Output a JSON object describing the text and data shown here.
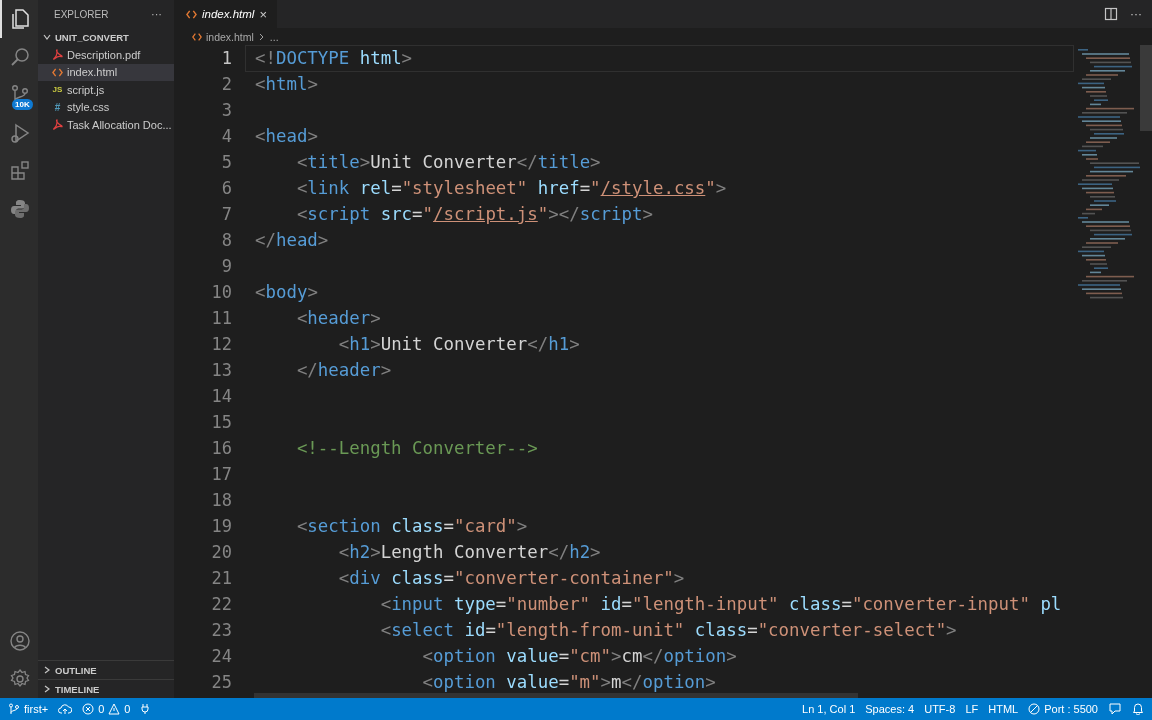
{
  "activity_bar": {
    "items": [
      {
        "kind": "explorer",
        "selected": true
      },
      {
        "kind": "search",
        "selected": false
      },
      {
        "kind": "source-control",
        "selected": false,
        "badge": "10K"
      },
      {
        "kind": "run",
        "selected": false
      },
      {
        "kind": "extensions",
        "selected": false
      },
      {
        "kind": "python",
        "selected": false
      }
    ],
    "bottom_items": [
      {
        "kind": "account"
      },
      {
        "kind": "settings"
      }
    ]
  },
  "sidebar": {
    "title": "EXPLORER",
    "more": "···",
    "folder": {
      "name": "UNIT_CONVERT",
      "expanded": true,
      "files": [
        {
          "name": "Description.pdf",
          "kind": "pdf",
          "selected": false
        },
        {
          "name": "index.html",
          "kind": "html",
          "selected": true
        },
        {
          "name": "script.js",
          "kind": "js",
          "glyph": "JS",
          "selected": false
        },
        {
          "name": "style.css",
          "kind": "css",
          "glyph": "#",
          "selected": false
        },
        {
          "name": "Task Allocation Doc...",
          "kind": "pdf",
          "selected": false
        }
      ]
    },
    "sections": [
      {
        "name": "OUTLINE",
        "expanded": false
      },
      {
        "name": "TIMELINE",
        "expanded": false
      }
    ]
  },
  "tabs": [
    {
      "label": "index.html",
      "selected": true,
      "preview": true,
      "close": "×"
    }
  ],
  "breadcrumb": [
    "index.html",
    "..."
  ],
  "editor_actions": {
    "more": "···"
  },
  "code": [
    {
      "number": "1",
      "current": true,
      "tokens": [
        {
          "kind": "punct",
          "text": "<!"
        },
        {
          "kind": "tag",
          "text": "DOCTYPE"
        },
        {
          "kind": "attr",
          "text": " html"
        },
        {
          "kind": "punct",
          "text": ">"
        }
      ]
    },
    {
      "number": "2",
      "current": false,
      "tokens": [
        {
          "kind": "punct",
          "text": "<"
        },
        {
          "kind": "tag",
          "text": "html"
        },
        {
          "kind": "punct",
          "text": ">"
        }
      ]
    },
    {
      "number": "3",
      "current": false
    },
    {
      "number": "4",
      "current": false,
      "tokens": [
        {
          "kind": "punct",
          "text": "<"
        },
        {
          "kind": "tag",
          "text": "head"
        },
        {
          "kind": "punct",
          "text": ">"
        }
      ]
    },
    {
      "number": "5",
      "current": false,
      "tokens": [
        {
          "kind": "punct",
          "text": "    <"
        },
        {
          "kind": "tag",
          "text": "title"
        },
        {
          "kind": "punct",
          "text": ">"
        },
        {
          "kind": "text",
          "text": "Unit Converter"
        },
        {
          "kind": "punct",
          "text": "</"
        },
        {
          "kind": "tag",
          "text": "title"
        },
        {
          "kind": "punct",
          "text": ">"
        }
      ]
    },
    {
      "number": "6",
      "current": false,
      "tokens": [
        {
          "kind": "punct",
          "text": "    <"
        },
        {
          "kind": "tag",
          "text": "link"
        },
        {
          "kind": "attr",
          "text": " rel"
        },
        {
          "kind": "text",
          "text": "="
        },
        {
          "kind": "string",
          "text": "\"stylesheet\""
        },
        {
          "kind": "attr",
          "text": " href"
        },
        {
          "kind": "text",
          "text": "="
        },
        {
          "kind": "string",
          "text": "\""
        },
        {
          "kind": "link",
          "text": "/style.css"
        },
        {
          "kind": "string",
          "text": "\""
        },
        {
          "kind": "punct",
          "text": ">"
        }
      ]
    },
    {
      "number": "7",
      "current": false,
      "tokens": [
        {
          "kind": "punct",
          "text": "    <"
        },
        {
          "kind": "tag",
          "text": "script"
        },
        {
          "kind": "attr",
          "text": " src"
        },
        {
          "kind": "text",
          "text": "="
        },
        {
          "kind": "string",
          "text": "\""
        },
        {
          "kind": "link",
          "text": "/script.js"
        },
        {
          "kind": "string",
          "text": "\""
        },
        {
          "kind": "punct",
          "text": "></"
        },
        {
          "kind": "tag",
          "text": "script"
        },
        {
          "kind": "punct",
          "text": ">"
        }
      ]
    },
    {
      "number": "8",
      "current": false,
      "tokens": [
        {
          "kind": "punct",
          "text": "</"
        },
        {
          "kind": "tag",
          "text": "head"
        },
        {
          "kind": "punct",
          "text": ">"
        }
      ]
    },
    {
      "number": "9",
      "current": false
    },
    {
      "number": "10",
      "current": false,
      "tokens": [
        {
          "kind": "punct",
          "text": "<"
        },
        {
          "kind": "tag",
          "text": "body"
        },
        {
          "kind": "punct",
          "text": ">"
        }
      ]
    },
    {
      "number": "11",
      "current": false,
      "tokens": [
        {
          "kind": "punct",
          "text": "    <"
        },
        {
          "kind": "tag",
          "text": "header"
        },
        {
          "kind": "punct",
          "text": ">"
        }
      ]
    },
    {
      "number": "12",
      "current": false,
      "tokens": [
        {
          "kind": "punct",
          "text": "        <"
        },
        {
          "kind": "tag",
          "text": "h1"
        },
        {
          "kind": "punct",
          "text": ">"
        },
        {
          "kind": "text",
          "text": "Unit Converter"
        },
        {
          "kind": "punct",
          "text": "</"
        },
        {
          "kind": "tag",
          "text": "h1"
        },
        {
          "kind": "punct",
          "text": ">"
        }
      ]
    },
    {
      "number": "13",
      "current": false,
      "tokens": [
        {
          "kind": "punct",
          "text": "    </"
        },
        {
          "kind": "tag",
          "text": "header"
        },
        {
          "kind": "punct",
          "text": ">"
        }
      ]
    },
    {
      "number": "14",
      "current": false
    },
    {
      "number": "15",
      "current": false
    },
    {
      "number": "16",
      "current": false,
      "tokens": [
        {
          "kind": "comment",
          "text": "    <!--Length Converter-->"
        }
      ]
    },
    {
      "number": "17",
      "current": false
    },
    {
      "number": "18",
      "current": false
    },
    {
      "number": "19",
      "current": false,
      "tokens": [
        {
          "kind": "punct",
          "text": "    <"
        },
        {
          "kind": "tag",
          "text": "section"
        },
        {
          "kind": "attr",
          "text": " class"
        },
        {
          "kind": "text",
          "text": "="
        },
        {
          "kind": "string",
          "text": "\"card\""
        },
        {
          "kind": "punct",
          "text": ">"
        }
      ]
    },
    {
      "number": "20",
      "current": false,
      "tokens": [
        {
          "kind": "punct",
          "text": "        <"
        },
        {
          "kind": "tag",
          "text": "h2"
        },
        {
          "kind": "punct",
          "text": ">"
        },
        {
          "kind": "text",
          "text": "Length Converter"
        },
        {
          "kind": "punct",
          "text": "</"
        },
        {
          "kind": "tag",
          "text": "h2"
        },
        {
          "kind": "punct",
          "text": ">"
        }
      ]
    },
    {
      "number": "21",
      "current": false,
      "tokens": [
        {
          "kind": "punct",
          "text": "        <"
        },
        {
          "kind": "tag",
          "text": "div"
        },
        {
          "kind": "attr",
          "text": " class"
        },
        {
          "kind": "text",
          "text": "="
        },
        {
          "kind": "string",
          "text": "\"converter-container\""
        },
        {
          "kind": "punct",
          "text": ">"
        }
      ]
    },
    {
      "number": "22",
      "current": false,
      "tokens": [
        {
          "kind": "punct",
          "text": "            <"
        },
        {
          "kind": "tag",
          "text": "input"
        },
        {
          "kind": "attr",
          "text": " type"
        },
        {
          "kind": "text",
          "text": "="
        },
        {
          "kind": "string",
          "text": "\"number\""
        },
        {
          "kind": "attr",
          "text": " id"
        },
        {
          "kind": "text",
          "text": "="
        },
        {
          "kind": "string",
          "text": "\"length-input\""
        },
        {
          "kind": "attr",
          "text": " class"
        },
        {
          "kind": "text",
          "text": "="
        },
        {
          "kind": "string",
          "text": "\"converter-input\""
        },
        {
          "kind": "attr",
          "text": " pl"
        }
      ]
    },
    {
      "number": "23",
      "current": false,
      "tokens": [
        {
          "kind": "punct",
          "text": "            <"
        },
        {
          "kind": "tag",
          "text": "select"
        },
        {
          "kind": "attr",
          "text": " id"
        },
        {
          "kind": "text",
          "text": "="
        },
        {
          "kind": "string",
          "text": "\"length-from-unit\""
        },
        {
          "kind": "attr",
          "text": " class"
        },
        {
          "kind": "text",
          "text": "="
        },
        {
          "kind": "string",
          "text": "\"converter-select\""
        },
        {
          "kind": "punct",
          "text": ">"
        }
      ]
    },
    {
      "number": "24",
      "current": false,
      "tokens": [
        {
          "kind": "punct",
          "text": "                <"
        },
        {
          "kind": "tag",
          "text": "option"
        },
        {
          "kind": "attr",
          "text": " value"
        },
        {
          "kind": "text",
          "text": "="
        },
        {
          "kind": "string",
          "text": "\"cm\""
        },
        {
          "kind": "punct",
          "text": ">"
        },
        {
          "kind": "text",
          "text": "cm"
        },
        {
          "kind": "punct",
          "text": "</"
        },
        {
          "kind": "tag",
          "text": "option"
        },
        {
          "kind": "punct",
          "text": ">"
        }
      ]
    },
    {
      "number": "25",
      "current": false,
      "tokens": [
        {
          "kind": "punct",
          "text": "                <"
        },
        {
          "kind": "tag",
          "text": "option"
        },
        {
          "kind": "attr",
          "text": " value"
        },
        {
          "kind": "text",
          "text": "="
        },
        {
          "kind": "string",
          "text": "\"m\""
        },
        {
          "kind": "punct",
          "text": ">"
        },
        {
          "kind": "text",
          "text": "m"
        },
        {
          "kind": "punct",
          "text": "</"
        },
        {
          "kind": "tag",
          "text": "option"
        },
        {
          "kind": "punct",
          "text": ">"
        }
      ]
    }
  ],
  "status_bar": {
    "branch": "first+",
    "errors": "0",
    "warnings": "0",
    "right": [
      "Ln 1, Col 1",
      "Spaces: 4",
      "UTF-8",
      "LF",
      "HTML"
    ],
    "port": "Port : 5500"
  }
}
